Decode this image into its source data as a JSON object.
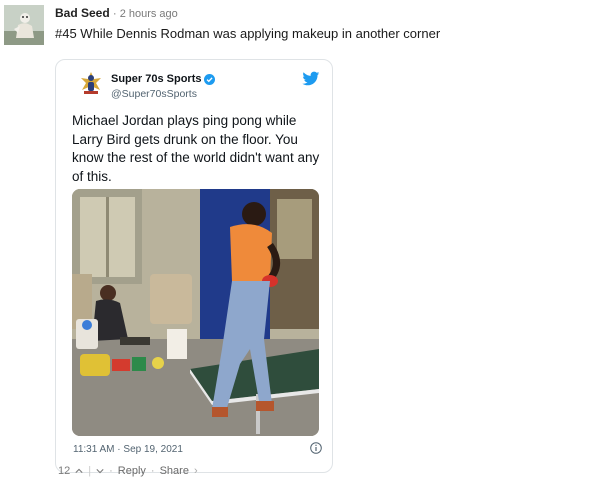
{
  "comment": {
    "author": "Bad Seed",
    "time": "2 hours ago",
    "text": "#45 While Dennis Rodman was applying makeup in another corner"
  },
  "tweet": {
    "display_name": "Super 70s Sports",
    "handle": "@Super70sSports",
    "text": "Michael Jordan plays ping pong while Larry Bird gets drunk on the floor. You know the rest of the world didn't want any of this.",
    "timestamp": "11:31 AM · Sep 19, 2021",
    "brand_color": "#1d9bf0"
  },
  "footer": {
    "votes": "12",
    "reply_label": "Reply",
    "share_label": "Share"
  }
}
